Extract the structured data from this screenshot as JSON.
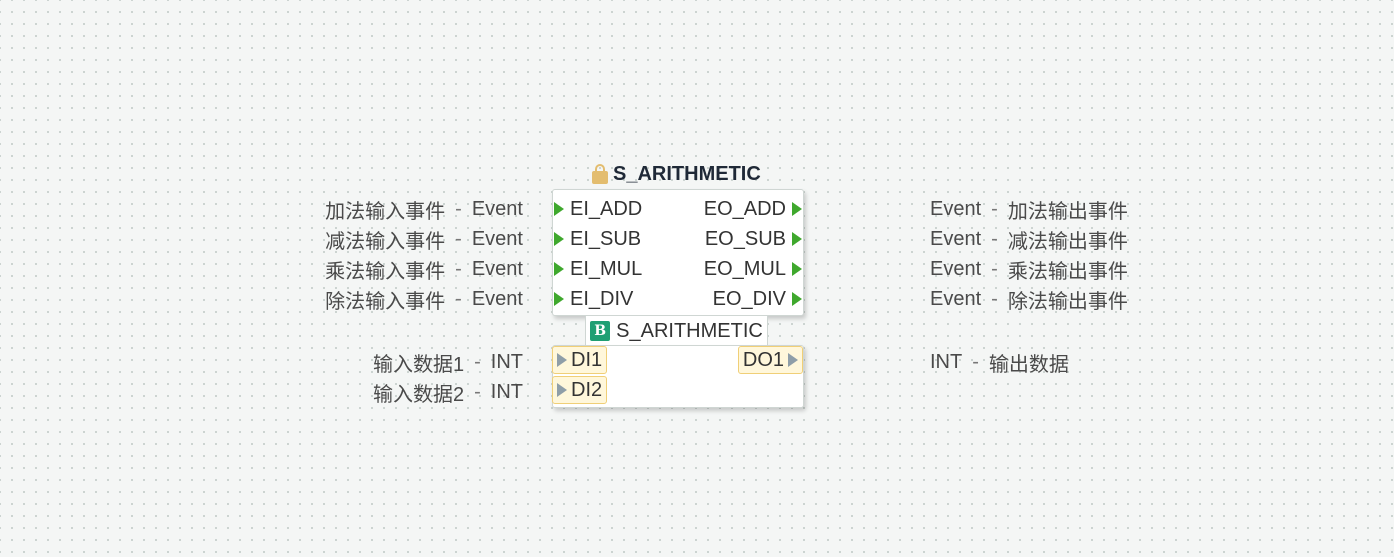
{
  "block": {
    "instance_name": "S_ARITHMETIC",
    "type_name": "S_ARITHMETIC",
    "type_icon_letter": "B"
  },
  "event_inputs": [
    {
      "name": "EI_ADD",
      "type": "Event",
      "comment": "加法输入事件"
    },
    {
      "name": "EI_SUB",
      "type": "Event",
      "comment": "减法输入事件"
    },
    {
      "name": "EI_MUL",
      "type": "Event",
      "comment": "乘法输入事件"
    },
    {
      "name": "EI_DIV",
      "type": "Event",
      "comment": "除法输入事件"
    }
  ],
  "event_outputs": [
    {
      "name": "EO_ADD",
      "type": "Event",
      "comment": "加法输出事件"
    },
    {
      "name": "EO_SUB",
      "type": "Event",
      "comment": "减法输出事件"
    },
    {
      "name": "EO_MUL",
      "type": "Event",
      "comment": "乘法输出事件"
    },
    {
      "name": "EO_DIV",
      "type": "Event",
      "comment": "除法输出事件"
    }
  ],
  "data_inputs": [
    {
      "name": "DI1",
      "type": "INT",
      "comment": "输入数据1"
    },
    {
      "name": "DI2",
      "type": "INT",
      "comment": "输入数据2"
    }
  ],
  "data_outputs": [
    {
      "name": "DO1",
      "type": "INT",
      "comment": "输出数据"
    }
  ],
  "separator": "-",
  "colors": {
    "event_port": "#3fa82d",
    "data_port": "#8f9ea8",
    "data_pill_bg": "#fff7db",
    "type_icon_bg": "#1e9f73",
    "lock": "#e3bd6f"
  },
  "icons": {
    "lock": "lock-icon",
    "type": "basic-fb-type-icon"
  }
}
